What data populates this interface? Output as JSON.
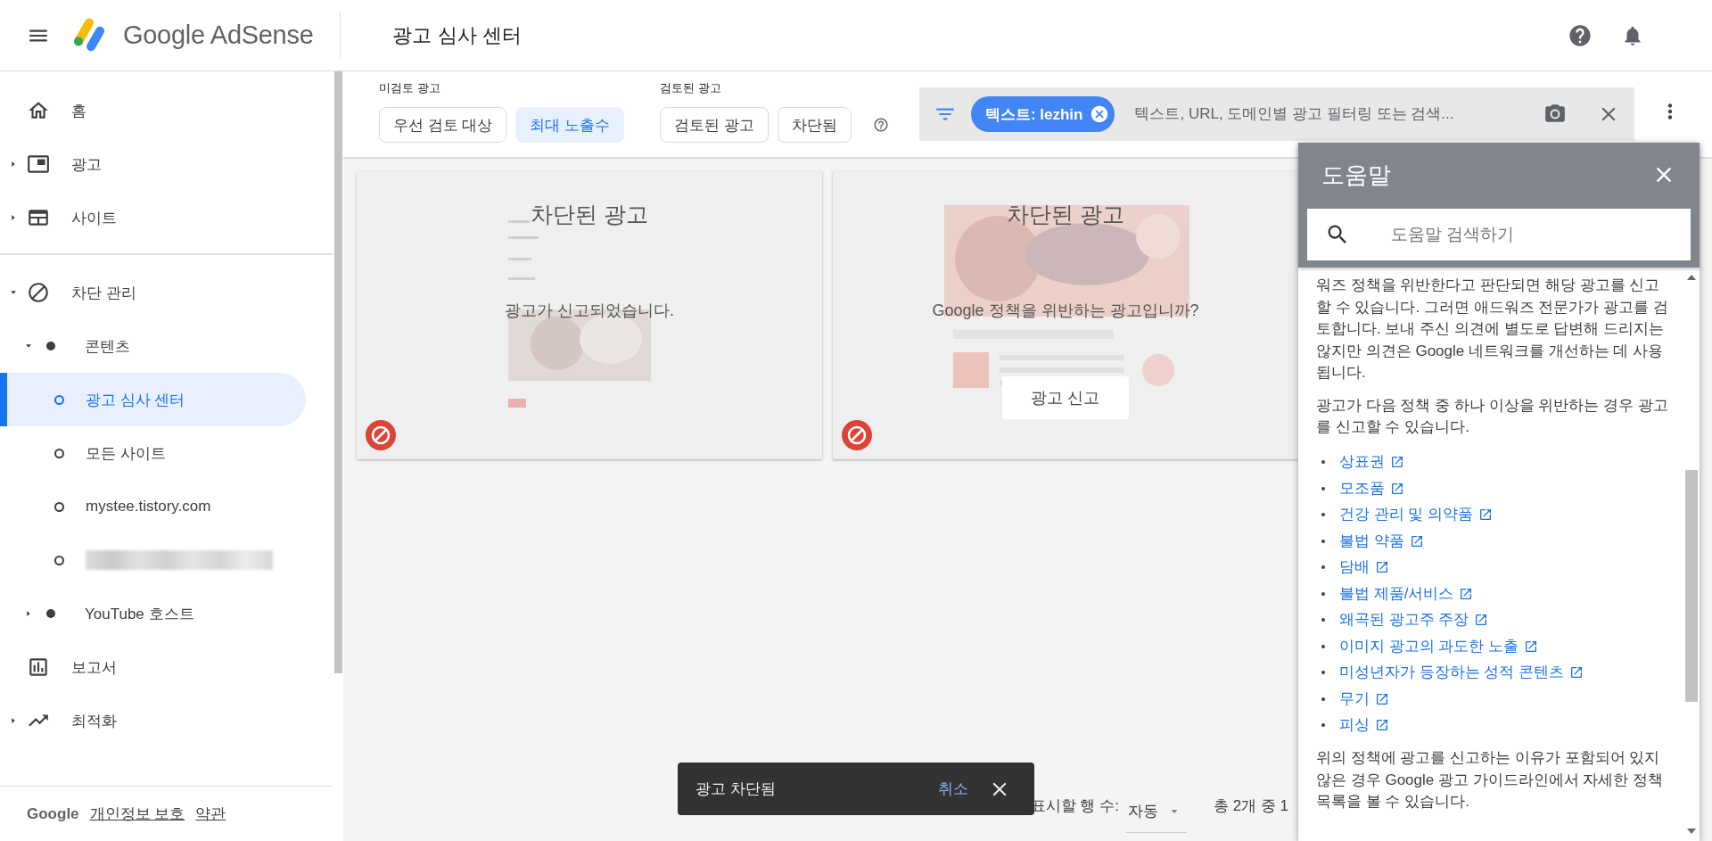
{
  "header": {
    "product": "Google AdSense",
    "title": "광고 심사 센터"
  },
  "sidebar": {
    "sections": [
      {
        "items": [
          {
            "label": "홈",
            "selected": false
          },
          {
            "label": "광고",
            "expanded": false,
            "selected": false
          },
          {
            "label": "사이트",
            "expanded": false,
            "selected": false
          }
        ]
      },
      {
        "items": [
          {
            "label": "차단 관리",
            "expanded": true,
            "selected": false,
            "children": [
              {
                "label": "콘텐츠",
                "expanded": true,
                "selected": false,
                "children": [
                  {
                    "kind": "link",
                    "label": "광고 심사 센터",
                    "selected": true
                  },
                  {
                    "kind": "link",
                    "label": "모든 사이트",
                    "selected": false
                  },
                  {
                    "kind": "link",
                    "label": "mystee.tistory.com",
                    "selected": false
                  },
                  {
                    "kind": "redacted",
                    "selected": false
                  }
                ]
              },
              {
                "label": "YouTube 호스트",
                "expanded": false,
                "selected": false
              }
            ]
          },
          {
            "label": "보고서",
            "selected": false
          },
          {
            "label": "최적화",
            "expanded": false,
            "selected": false
          }
        ]
      }
    ],
    "footer": {
      "brand": "Google",
      "links": [
        "개인정보 보호",
        "약관"
      ]
    }
  },
  "filters": {
    "groups": [
      {
        "label": "미검토 광고",
        "chips": [
          {
            "label": "우선 검토 대상",
            "selected": false
          },
          {
            "label": "최대 노출수",
            "selected": true
          }
        ]
      },
      {
        "label": "검토된 광고",
        "chips": [
          {
            "label": "검토된 광고",
            "selected": false
          },
          {
            "label": "차단됨",
            "selected": false
          }
        ]
      }
    ],
    "search": {
      "chips": [
        "텍스트: lezhin"
      ],
      "placeholder": "텍스트, URL, 도메인별 광고 필터링 또는 검색..."
    }
  },
  "cards": [
    {
      "title": "차단된 광고",
      "message": "광고가 신고되었습니다.",
      "blocked": true
    },
    {
      "title": "차단된 광고",
      "message": "Google 정책을 위반하는 광고입니까?",
      "action": "광고 신고",
      "blocked": true
    }
  ],
  "pager": {
    "rows_label": "표시할 행 수:",
    "rows_value": "자동",
    "range": "총 2개 중 1"
  },
  "snackbar": {
    "message": "광고 차단됨",
    "action": "취소"
  },
  "help": {
    "title": "도움말",
    "search_placeholder": "도움말 검색하기",
    "paragraphs": [
      "워즈 정책을 위반한다고 판단되면 해당 광고를 신고할 수 있습니다. 그러면 애드워즈 전문가가 광고를 검토합니다. 보내 주신 의견에 별도로 답변해 드리지는 않지만 의견은 Google 네트워크를 개선하는 데 사용됩니다.",
      "광고가 다음 정책 중 하나 이상을 위반하는 경우 광고를 신고할 수 있습니다."
    ],
    "links": [
      "상표권",
      "모조품",
      "건강 관리 및 의약품",
      "불법 약품",
      "담배",
      "불법 제품/서비스",
      "왜곡된 광고주 주장",
      "이미지 광고의 과도한 노출",
      "미성년자가 등장하는 성적 콘텐츠",
      "무기",
      "피싱"
    ],
    "closing": "위의 정책에 광고를 신고하는 이유가 포함되어 있지 않은 경우 Google 광고 가이드라인에서 자세한 정책 목록을 볼 수 있습니다."
  }
}
